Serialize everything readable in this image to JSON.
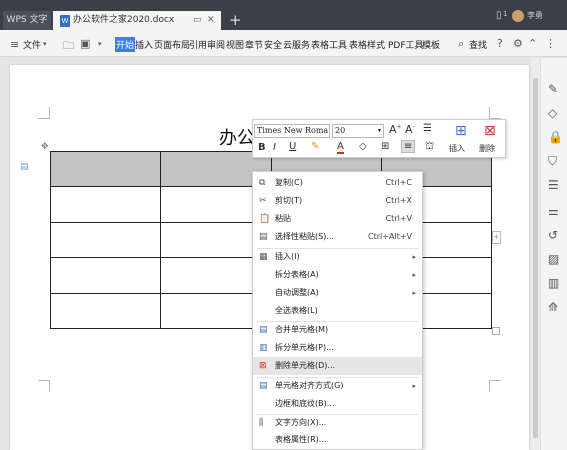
{
  "titlebar": {
    "wps_tab": "WPS 文字",
    "doc_tab": "办公软件之家2020.docx",
    "new_tab": "+",
    "user": "李勇",
    "tab_count": "1"
  },
  "menubar": {
    "file": "文件",
    "items": [
      "开始",
      "插入",
      "页面布局",
      "引用",
      "审阅",
      "视图",
      "章节",
      "安全",
      "云服务",
      "表格工具",
      "表格样式",
      "PDF工具",
      "模板"
    ],
    "search": "查找"
  },
  "document": {
    "title": "办公"
  },
  "mini_toolbar": {
    "font": "Times New Roma",
    "size": "20",
    "insert": "插入",
    "delete": "删除"
  },
  "context_menu": [
    {
      "label": "复制(C)",
      "shortcut": "Ctrl+C",
      "icon": "copy-icon"
    },
    {
      "label": "剪切(T)",
      "shortcut": "Ctrl+X",
      "icon": "scissors-icon"
    },
    {
      "label": "粘贴",
      "shortcut": "Ctrl+V",
      "icon": "paste-icon"
    },
    {
      "label": "选择性粘贴(S)...",
      "shortcut": "Ctrl+Alt+V",
      "icon": "paste-special-icon"
    },
    {
      "label": "插入(I)",
      "shortcut": "",
      "icon": "insert-icon",
      "submenu": true
    },
    {
      "label": "拆分表格(A)",
      "shortcut": "",
      "icon": "",
      "submenu": true
    },
    {
      "label": "自动调整(A)",
      "shortcut": "",
      "icon": "",
      "submenu": true
    },
    {
      "label": "全选表格(L)",
      "shortcut": "",
      "icon": ""
    },
    {
      "label": "合并单元格(M)",
      "shortcut": "",
      "icon": "merge-cells-icon"
    },
    {
      "label": "拆分单元格(P)...",
      "shortcut": "",
      "icon": "split-cells-icon"
    },
    {
      "label": "删除单元格(D)...",
      "shortcut": "",
      "icon": "delete-cells-icon"
    },
    {
      "label": "单元格对齐方式(G)",
      "shortcut": "",
      "icon": "cell-align-icon",
      "submenu": true
    },
    {
      "label": "边框和底纹(B)...",
      "shortcut": "",
      "icon": ""
    },
    {
      "label": "文字方向(X)...",
      "shortcut": "",
      "icon": "text-direction-icon"
    },
    {
      "label": "表格属性(R)...",
      "shortcut": "",
      "icon": ""
    }
  ],
  "colors": {
    "accent": "#3f7ee6",
    "titlebar": "#3b4048",
    "highlight": "#e6e6e6",
    "delete_icon": "#d33"
  }
}
